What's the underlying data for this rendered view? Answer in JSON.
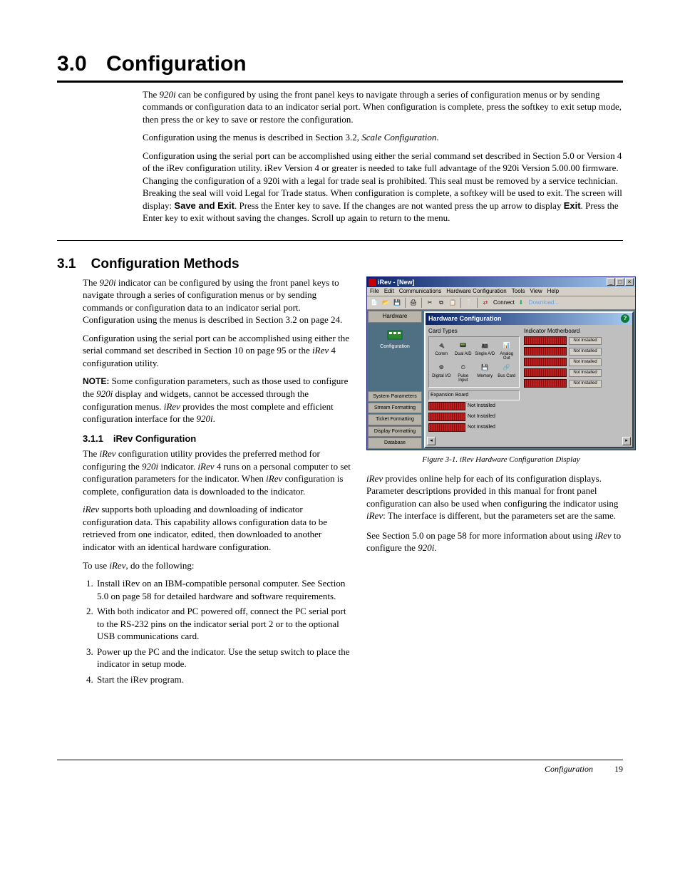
{
  "chapter": {
    "num": "3.0",
    "title": "Configuration"
  },
  "intro": {
    "p1a": "The ",
    "p1b": "920i",
    "p1c": " can be configured by using the front panel keys to navigate through a series of configuration menus or by sending commands or configuration data to an indicator serial port. When configuration is complete, press the softkey to exit setup mode, then press the or key to save or restore the configuration.",
    "p2a": "Configuration using the menus is described in Section 3.2, ",
    "p2b": "Scale Configuration",
    "p2c": ".",
    "p3": "Configuration using the serial port can be accomplished using either the serial command set described in Section 5.0 or the iRev configuration utility.",
    "p4a": "Configuration using the serial port can be accomplished using either the serial command set described in Section 5.0 or Version 4 of the iRev configuration utility. iRev Version 4 or greater is needed to take full advantage of the 920i Version 5.00.00 firmware. Changing the configuration of a 920i with a legal for trade seal is prohibited. This seal must be removed by a service technician. Breaking the seal will void Legal for Trade status. When configuration is complete, a softkey will be used to exit. The screen will display: ",
    "p4b": "Save and Exit",
    "p4c": ". Press the Enter key to save. If the changes are not wanted press the up arrow to display ",
    "p4d": "Exit",
    "p4e": ". Press the Enter key to exit without saving the changes. Scroll up again to return to the menu."
  },
  "section": {
    "num": "3.1",
    "title": "Configuration Methods"
  },
  "left": {
    "p1a": "The ",
    "p1b": "920i",
    "p1c": " indicator can be configured by using the front panel keys to navigate through a series of configuration menus or by sending commands or configuration data to an indicator serial port. Configuration using the menus is described in Section 3.2 on page 24.",
    "p2": "Configuration using the serial port can be accomplished using either the serial command set described in Section 10 on page 95 or the iRev 4™ configuration utility.",
    "p3a": "Configuration using the serial port can be accomplished using either the serial command set described in Section 10 on page 95 or the ",
    "p3b": "iRev",
    "p3c": " 4 configuration utility.",
    "note": "NOTE:",
    "p4a": " Some configuration parameters, such as those used to configure the ",
    "p4b": "920i",
    "p4c": " display and widgets, cannot be accessed through the configuration menus. ",
    "p4d": "iRev",
    "p4e": " provides the most complete and efficient configuration interface for the ",
    "p4f": "920i",
    "p4g": ".",
    "subsec": {
      "num": "3.1.1",
      "title": "iRev Configuration",
      "numlabel": "3.1.1"
    },
    "p5a": "The ",
    "p5b": "iRev",
    "p5c": " configuration utility provides the preferred method for configuring the ",
    "p5d": "920i",
    "p5e": " indicator. ",
    "p5f": "iRev",
    "p5g": " 4 runs on a personal computer to set configuration parameters for the indicator. When ",
    "p5h": "iRev",
    "p5i": " configuration is complete, configuration data is downloaded to the indicator.",
    "p6a": "iRev",
    "p6b": " supports both uploading and downloading of indicator configuration data. This capability allows configuration data to be retrieved from one indicator, edited, then downloaded to another indicator with an identical hardware configuration.",
    "p7a": "To use ",
    "p7b": "iRev",
    "p7c": ", do the following:",
    "steps": [
      "Install iRev on an IBM-compatible personal computer. See Section 5.0 on page 58 for detailed hardware and software requirements.",
      "With both indicator and PC powered off, connect the PC serial port to the RS-232 pins on the indicator serial port 2 or to the optional USB communications card.",
      "Power up the PC and the indicator. Use the setup switch to place the indicator in setup mode.",
      "Start the iRev program."
    ]
  },
  "right": {
    "fig_caption": "Figure 3-1. iRev Hardware Configuration Display",
    "p1a": "",
    "p1b": "iRev",
    "p1c": " provides online help for each of its configuration displays. Parameter descriptions provided in this manual for front panel configuration can also be used when configuring the indicator using ",
    "p1d": "iRev",
    "p1e": ": The interface is different, but the parameters set are the same.",
    "p2a": "See Section 5.0 on page 58 for more information about using ",
    "p2b": "iRev",
    "p2c": " to configure the ",
    "p2d": "920i",
    "p2e": "."
  },
  "figure": {
    "title": "iRev - [New]",
    "menus": [
      "File",
      "Edit",
      "Communications",
      "Hardware Configuration",
      "Tools",
      "View",
      "Help"
    ],
    "toolbar": {
      "connect": "Connect",
      "download": "Download..."
    },
    "left_tabs": {
      "hardware": "Hardware",
      "configuration": "Configuration"
    },
    "left_bottom": [
      "System Parameters",
      "Stream Formatting",
      "Ticket Formatting",
      "Display Formatting",
      "Database"
    ],
    "inner_title": "Hardware Configuration",
    "card_types_label": "Card Types",
    "card_types": [
      [
        "Comm",
        "Dual A/D",
        "Single A/D",
        "Analog Out"
      ],
      [
        "Digital I/O",
        "Pulse Input",
        "Memory",
        "Bus Card"
      ]
    ],
    "expansion_label": "Expansion Board",
    "slot_status": "Not Installed",
    "mb_label": "Indicator Motherboard"
  },
  "footer": {
    "label": "Configuration",
    "page": "19"
  }
}
